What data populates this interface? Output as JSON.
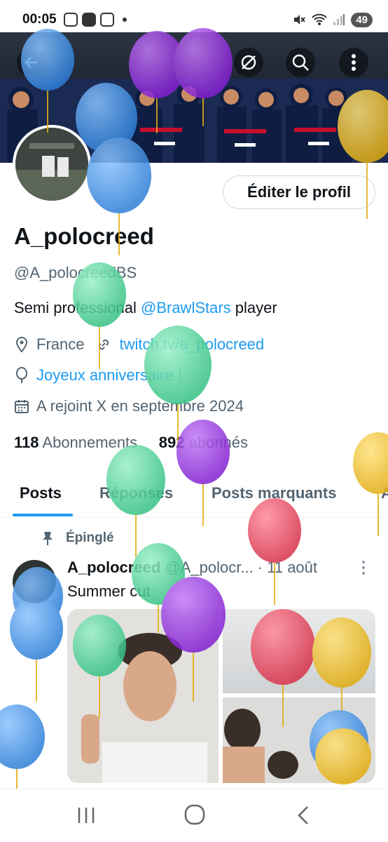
{
  "status_bar": {
    "time": "00:05",
    "battery": "49"
  },
  "profile": {
    "display_name": "A_polocreed",
    "handle": "@A_polocreedBS",
    "bio_prefix": "Semi professional ",
    "bio_mention": "@BrawlStars",
    "bio_suffix": " player",
    "location": "France",
    "website": "twitch.tv/a_polocreed",
    "birthday_text": "Joyeux anniversaire !",
    "joined": "A rejoint X en septembre 2024",
    "following_count": "118",
    "following_label": "Abonnements",
    "followers_count": "892",
    "followers_label": "abonnés",
    "edit_button": "Éditer le profil"
  },
  "tabs": [
    "Posts",
    "Réponses",
    "Posts marquants",
    "A"
  ],
  "pinned_post": {
    "pinned_label": "Épinglé",
    "author": "A_polocreed",
    "handle": "@A_polocr...",
    "date": "· 11 août",
    "text": "Summer cut"
  },
  "colors": {
    "accent": "#1d9bf0",
    "balloon_blue": "#4a97e8",
    "balloon_green": "#5fd6a0",
    "balloon_purple": "#9a3be0",
    "balloon_yellow": "#f2c531",
    "balloon_red": "#e94a62"
  },
  "icons": [
    "back-arrow-icon",
    "sync-off-icon",
    "search-icon",
    "more-vertical-icon",
    "location-pin-icon",
    "link-icon",
    "balloon-icon",
    "calendar-icon",
    "pin-icon",
    "more-icon",
    "recent-apps-icon",
    "home-icon",
    "back-icon"
  ]
}
